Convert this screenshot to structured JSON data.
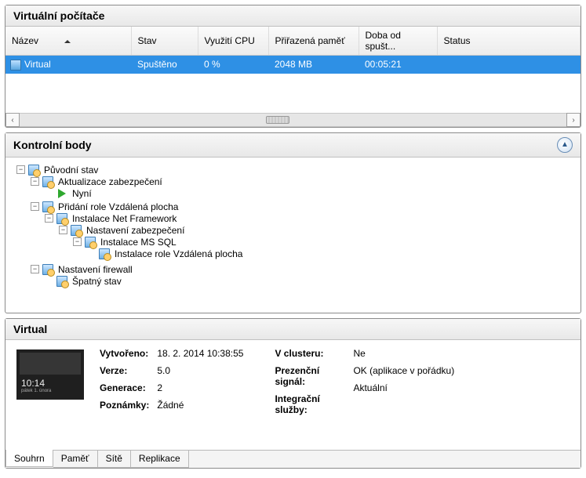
{
  "vm_panel": {
    "title": "Virtuální počítače",
    "columns": [
      "Název",
      "Stav",
      "Využití CPU",
      "Přiřazená paměť",
      "Doba od spušt...",
      "Status"
    ],
    "rows": [
      {
        "name": "Virtual",
        "state": "Spuštěno",
        "cpu": "0 %",
        "mem": "2048 MB",
        "uptime": "00:05:21",
        "status": ""
      }
    ]
  },
  "checkpoints": {
    "title": "Kontrolní body",
    "tree": {
      "root": "Původní stav",
      "n1": "Aktualizace zabezpečení",
      "now": "Nyní",
      "n2": "Přidání role Vzdálená plocha",
      "n3": "Instalace Net Framework",
      "n4": "Nastavení zabezpečení",
      "n5": "Instalace MS SQL",
      "n6": "Instalace role Vzdálená plocha",
      "n7": "Nastavení firewall",
      "n8": "Špatný stav"
    }
  },
  "details": {
    "title": "Virtual",
    "thumb_time": "10:14",
    "thumb_sub": "pátek 1. února",
    "left": {
      "created_k": "Vytvořeno:",
      "created_v": "18. 2. 2014 10:38:55",
      "version_k": "Verze:",
      "version_v": "5.0",
      "gen_k": "Generace:",
      "gen_v": "2",
      "notes_k": "Poznámky:",
      "notes_v": "Žádné"
    },
    "right": {
      "cluster_k": "V clusteru:",
      "cluster_v": "Ne",
      "heartbeat_k": "Prezenční signál:",
      "heartbeat_v": "OK (aplikace v pořádku)",
      "integ_k": "Integrační služby:",
      "integ_v": "Aktuální"
    },
    "tabs": [
      "Souhrn",
      "Paměť",
      "Sítě",
      "Replikace"
    ]
  }
}
